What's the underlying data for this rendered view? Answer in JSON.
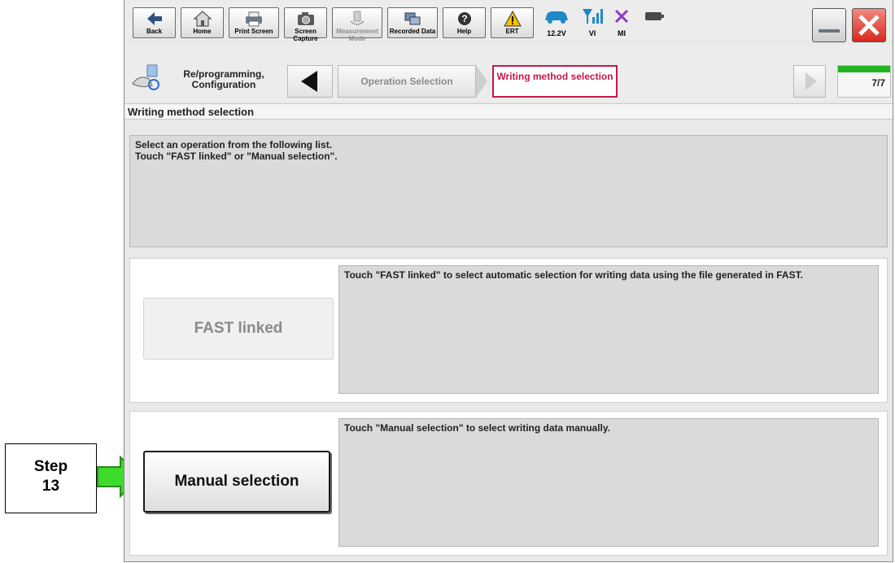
{
  "toolbar": {
    "back": "Back",
    "home": "Home",
    "print_screen": "Print Screen",
    "screen_capture": "Screen Capture",
    "measurement_mode": "Measurement Mode",
    "recorded_data": "Recorded Data",
    "help": "Help",
    "ert": "ERT",
    "voltage": "12.2V",
    "vi": "VI",
    "mi": "MI"
  },
  "breadcrumb": {
    "reprogramming": "Re/programming, Configuration",
    "operation_selection": "Operation Selection",
    "writing_method": "Writing method selection",
    "page_counter": "7/7"
  },
  "page_title": "Writing method selection",
  "instructions": {
    "line1": "Select an operation from the following list.",
    "line2": "Touch \"FAST linked\" or \"Manual selection\"."
  },
  "options": {
    "fast_label": "FAST linked",
    "fast_desc": "Touch \"FAST linked\" to select automatic selection for writing data using the file generated in FAST.",
    "manual_label": "Manual selection",
    "manual_desc": "Touch \"Manual selection\" to select writing data manually."
  },
  "callout": {
    "line1": "Step",
    "line2": "13"
  },
  "colors": {
    "active_tab_border": "#c8174b",
    "active_tab_text": "#c8174b",
    "arrow_green": "#3ddc2a",
    "progress_green": "#21b51f",
    "close_red": "#e0302a"
  }
}
